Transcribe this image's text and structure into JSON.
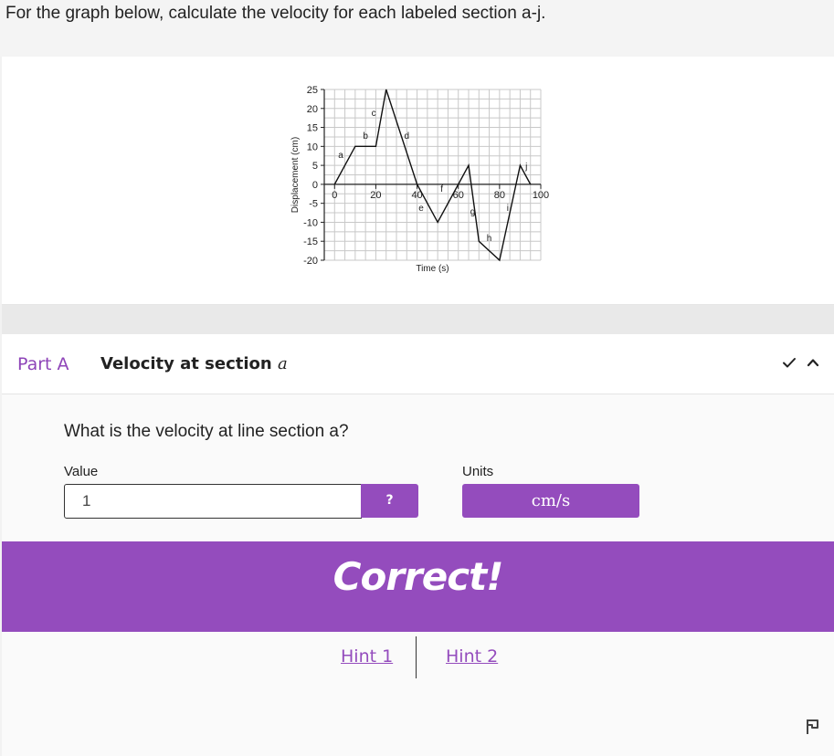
{
  "question": {
    "text": "For the graph below, calculate the velocity for each labeled section a-j."
  },
  "chart_data": {
    "type": "line",
    "xlabel": "Time (s)",
    "ylabel": "Displacement (cm)",
    "xlim": [
      -5,
      100
    ],
    "ylim": [
      -20,
      25
    ],
    "x_ticks": [
      "0",
      "20",
      "40",
      "60",
      "80",
      "100"
    ],
    "y_ticks": [
      "25",
      "20",
      "15",
      "10",
      "5",
      "0",
      "-5",
      "-10",
      "-15",
      "-20"
    ],
    "grid": true,
    "series": [
      {
        "x": [
          0,
          10,
          20,
          25,
          40,
          50,
          65,
          70,
          80,
          90,
          95
        ],
        "y": [
          0,
          10,
          10,
          25,
          0,
          -10,
          5,
          -15,
          -20,
          5,
          0
        ]
      }
    ],
    "section_labels": [
      {
        "label": "a",
        "x": 3,
        "y": 7
      },
      {
        "label": "b",
        "x": 15,
        "y": 12
      },
      {
        "label": "c",
        "x": 19,
        "y": 18
      },
      {
        "label": "d",
        "x": 35,
        "y": 12
      },
      {
        "label": "e",
        "x": 42,
        "y": -7
      },
      {
        "label": "f",
        "x": 52,
        "y": -2
      },
      {
        "label": "g",
        "x": 67,
        "y": -8
      },
      {
        "label": "h",
        "x": 75,
        "y": -15
      },
      {
        "label": "i",
        "x": 84,
        "y": -7
      },
      {
        "label": "j",
        "x": 93,
        "y": 4
      }
    ]
  },
  "part": {
    "label": "Part A",
    "title": "Velocity at section",
    "title_var": "a",
    "prompt": "What is the velocity at line section a?",
    "value_label": "Value",
    "value": "1",
    "help_label": "?",
    "units_label": "Units",
    "units_value": "cm/s",
    "feedback": "Correct!",
    "hint1": "Hint 1",
    "hint2": "Hint 2"
  },
  "icons": {
    "check": "check-icon",
    "collapse": "chevron-up-icon",
    "flag": "flag-icon"
  },
  "colors": {
    "accent": "#944cbd"
  }
}
